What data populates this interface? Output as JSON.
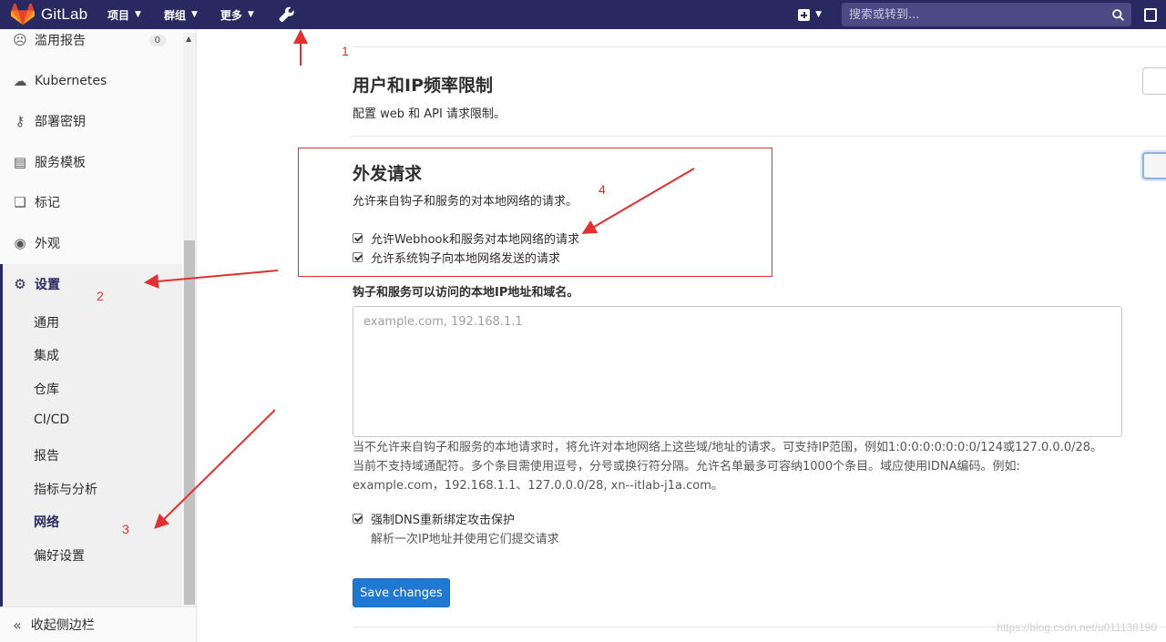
{
  "navbar": {
    "brand": "GitLab",
    "menus": [
      "项目",
      "群组",
      "更多"
    ],
    "search_placeholder": "搜索或转到..."
  },
  "sidebar": {
    "items": [
      {
        "label": "滥用报告",
        "icon": "abuse-report-icon",
        "badge": "0"
      },
      {
        "label": "Kubernetes",
        "icon": "kubernetes-icon"
      },
      {
        "label": "部署密钥",
        "icon": "key-icon"
      },
      {
        "label": "服务模板",
        "icon": "template-icon"
      },
      {
        "label": "标记",
        "icon": "label-icon"
      },
      {
        "label": "外观",
        "icon": "palette-icon"
      },
      {
        "label": "设置",
        "icon": "gear-icon"
      }
    ],
    "settings_sub": [
      "通用",
      "集成",
      "仓库",
      "CI/CD",
      "报告",
      "指标与分析",
      "网络",
      "偏好设置"
    ],
    "collapse_label": "收起侧边栏"
  },
  "main": {
    "rate_limit": {
      "title": "用户和IP频率限制",
      "desc": "配置 web 和 API 请求限制。"
    },
    "outbound": {
      "title": "外发请求",
      "desc": "允许来自钩子和服务的对本地网络的请求。",
      "check1": "允许Webhook和服务对本地网络的请求",
      "check2": "允许系统钩子向本地网络发送的请求"
    },
    "allowlist": {
      "label": "钩子和服务可以访问的本地IP地址和域名。",
      "placeholder": "example.com, 192.168.1.1",
      "help1": "当不允许来自钩子和服务的本地请求时，将允许对本地网络上这些域/地址的请求。可支持IP范围，例如1:0:0:0:0:0:0:0/124或127.0.0.0/28。",
      "help2": "当前不支持域通配符。多个条目需使用逗号，分号或换行符分隔。允许名单最多可容纳1000个条目。域应使用IDNA编码。例如:",
      "help3": "example.com，192.168.1.1、127.0.0.0/28, xn--itlab-j1a.com。"
    },
    "dns": {
      "check": "强制DNS重新绑定攻击保护",
      "sub": "解析一次IP地址并使用它们提交请求"
    },
    "save_label": "Save changes"
  },
  "annotations": [
    "1",
    "2",
    "3",
    "4"
  ],
  "watermark": "https://blog.csdn.net/u011138190",
  "colors": {
    "navbar": "#292961",
    "primary": "#1f78d1",
    "annotation": "#e03030"
  }
}
